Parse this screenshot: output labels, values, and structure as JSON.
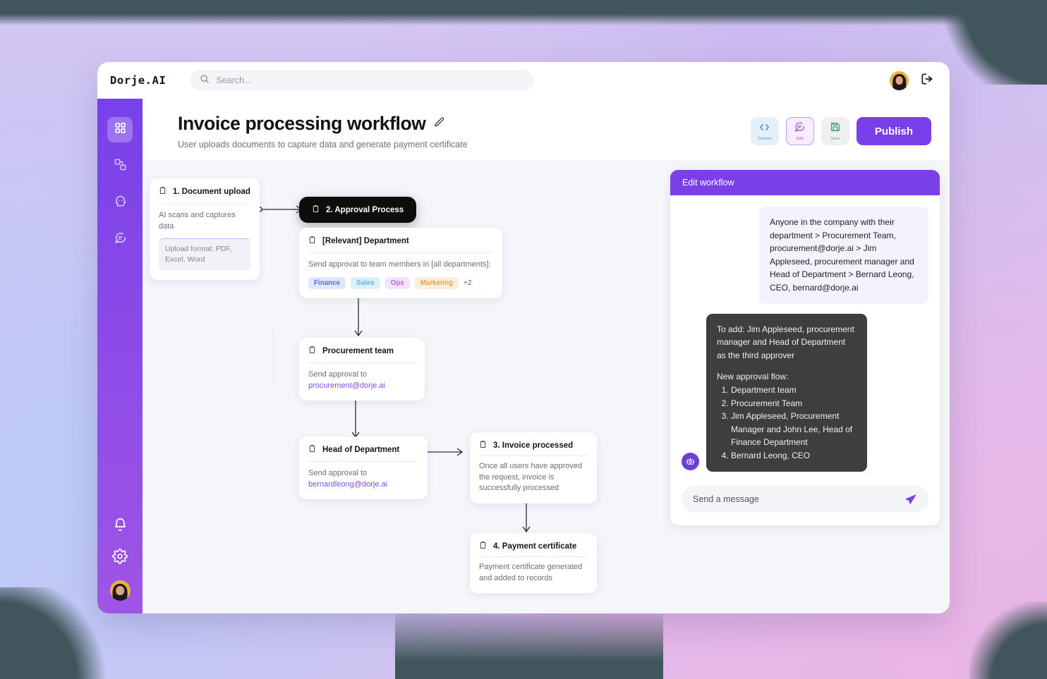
{
  "brand": "Dorje.AI",
  "search": {
    "placeholder": "Search..."
  },
  "header": {
    "title": "Invoice processing workflow",
    "subtitle": "User uploads documents to capture data and generate payment certificate",
    "actions": {
      "toolbox": "Toolbox",
      "edit": "Edit",
      "save": "Save",
      "publish": "Publish"
    }
  },
  "sidebar": {
    "items": [
      {
        "name": "dashboard",
        "active": true
      },
      {
        "name": "workflows",
        "active": false
      },
      {
        "name": "assistant",
        "active": false
      },
      {
        "name": "messages",
        "active": false
      }
    ],
    "bottom": [
      {
        "name": "notifications"
      },
      {
        "name": "settings"
      },
      {
        "name": "profile"
      }
    ]
  },
  "workflow": {
    "nodes": {
      "document_upload": {
        "title": "1. Document upload",
        "body": "AI scans and captures data",
        "chip": "Upload format: PDF, Excel, Word"
      },
      "approval_process": {
        "title": "2. Approval Process"
      },
      "relevant_department": {
        "title": "[Relevant]  Department",
        "body": "Send approval to team members in [all departments]:",
        "tags": [
          "Finance",
          "Sales",
          "Ops",
          "Marketing"
        ],
        "more": "+2"
      },
      "procurement_team": {
        "title": "Procurement team",
        "body": "Send approval to",
        "email": "procurement@dorje.ai"
      },
      "head_of_department": {
        "title": "Head of Department",
        "body": "Send approval to",
        "email": "bernardleong@dorje.ai"
      },
      "invoice_processed": {
        "title": "3. Invoice processed",
        "body": "Once all users have approved the request, invoice is successfully processed"
      },
      "payment_certificate": {
        "title": "4. Payment certificate",
        "body": "Payment certificate generated and added to records"
      }
    }
  },
  "chat": {
    "header": "Edit workflow",
    "user_message": "Anyone in the company with their department > Procurement Team, procurement@dorje.ai > Jim Appleseed, procurement manager and Head of Department > Bernard Leong, CEO, bernard@dorje.ai",
    "bot_intro": "To add: Jim Appleseed, procurement manager and Head of Department as the third approver",
    "bot_list_title": "New approval flow:",
    "bot_list": [
      "Department team",
      "Procurement Team",
      "Jim Appleseed, Procurement Manager and John Lee, Head of Finance Department",
      "Bernard Leong, CEO"
    ],
    "composer_placeholder": "Send a message"
  },
  "colors": {
    "brand_purple": "#7a3fe8",
    "dark_node": "#0f0c0c",
    "bot_bubble": "#3e3e41",
    "link": "#7a4fe0"
  }
}
